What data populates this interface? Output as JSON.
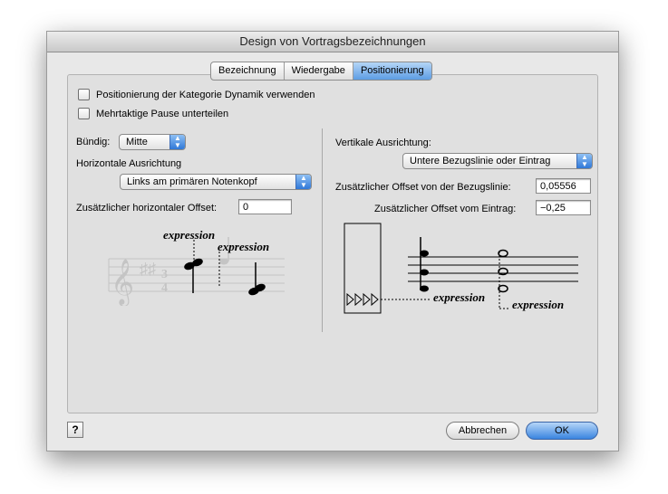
{
  "window": {
    "title": "Design von Vortragsbezeichnungen"
  },
  "tabs": [
    {
      "label": "Bezeichnung",
      "active": false
    },
    {
      "label": "Wiedergabe",
      "active": false
    },
    {
      "label": "Positionierung",
      "active": true
    }
  ],
  "checkboxes": {
    "use_dynamic_category": {
      "label": "Positionierung der Kategorie Dynamik verwenden",
      "checked": false
    },
    "split_multimeasure_rest": {
      "label": "Mehrtaktige Pause unterteilen",
      "checked": false
    }
  },
  "left": {
    "align_label": "Bündig:",
    "align_value": "Mitte",
    "horizontal_label": "Horizontale Ausrichtung",
    "horizontal_value": "Links am primären Notenkopf",
    "h_offset_label": "Zusätzlicher horizontaler Offset:",
    "h_offset_value": "0",
    "preview": {
      "expr1": "expression",
      "expr2": "expression"
    }
  },
  "right": {
    "vertical_label": "Vertikale Ausrichtung:",
    "vertical_value": "Untere Bezugslinie oder Eintrag",
    "baseline_offset_label": "Zusätzlicher Offset von der Bezugslinie:",
    "baseline_offset_value": "0,05556",
    "entry_offset_label": "Zusätzlicher Offset vom Eintrag:",
    "entry_offset_value": "−0,25",
    "preview": {
      "expr1": "expression",
      "expr2": "expression"
    }
  },
  "buttons": {
    "help": "?",
    "cancel": "Abbrechen",
    "ok": "OK"
  },
  "colors": {
    "accent": "#3a85e0",
    "window_bg": "#e8e8e8"
  }
}
